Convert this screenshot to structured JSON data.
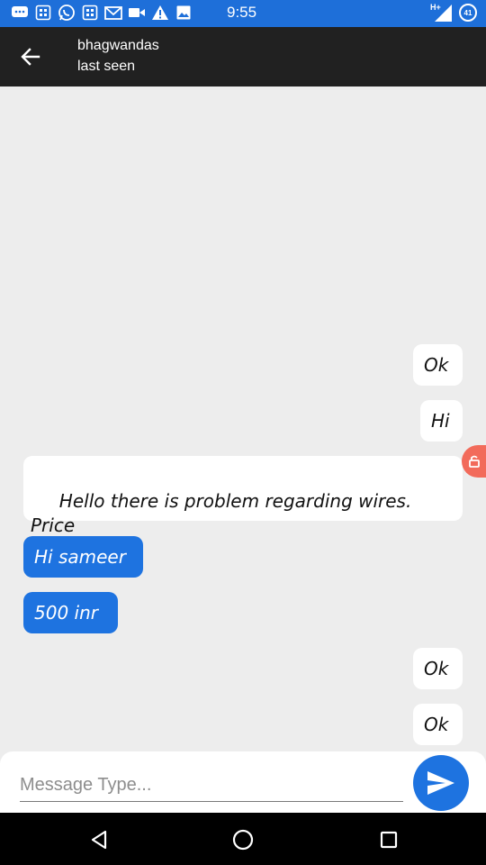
{
  "status_bar": {
    "time": "9:55",
    "battery_level": "41",
    "network": "H+",
    "left_icons": [
      "sms-icon",
      "calculator-icon",
      "whatsapp-icon",
      "calculator-icon",
      "gmail-icon",
      "video-icon",
      "warning-icon",
      "image-icon"
    ]
  },
  "header": {
    "contact_name": "bhagwandas",
    "status": "last seen"
  },
  "messages": [
    {
      "text": "Ok",
      "type": "sent"
    },
    {
      "text": "Hi",
      "type": "sent"
    },
    {
      "text": " Hello there is problem regarding wires. Price",
      "type": "sent"
    },
    {
      "text": "Hi sameer",
      "type": "received"
    },
    {
      "text": "500 inr",
      "type": "received"
    },
    {
      "text": "Ok",
      "type": "sent"
    },
    {
      "text": "Ok",
      "type": "sent"
    }
  ],
  "composer": {
    "placeholder": "Message Type..."
  },
  "colors": {
    "accent": "#1e73e0",
    "status_bar": "#1e6fd9",
    "app_bar": "#212121",
    "chat_background": "#ededed",
    "floating_button": "#f26b5b"
  }
}
